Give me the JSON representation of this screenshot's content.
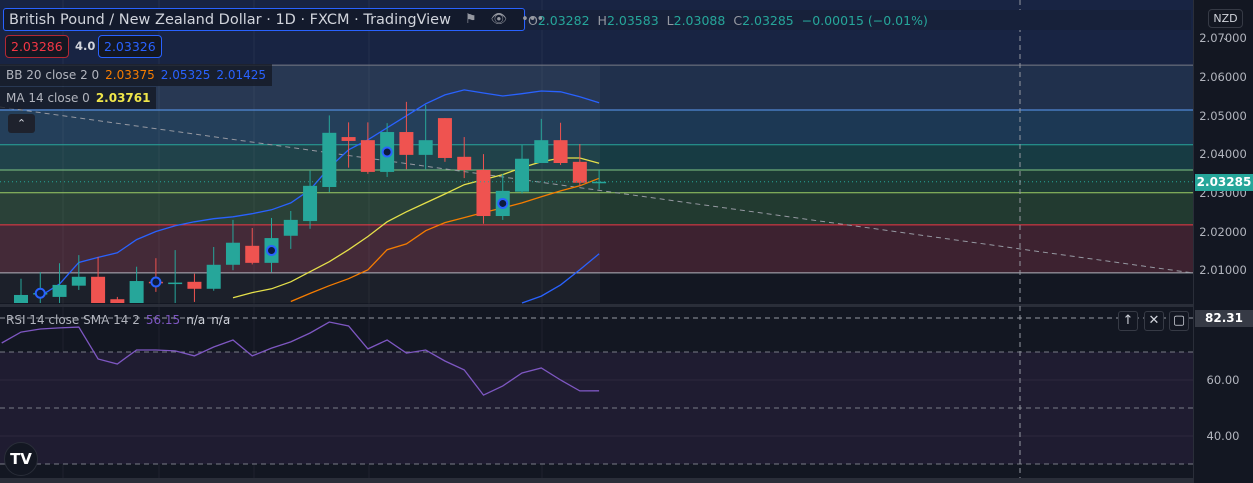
{
  "header": {
    "title": "British Pound / New Zealand Dollar · 1D · FXCM · TradingView",
    "icons": [
      "flag-icon",
      "eye-icon",
      "more-icon"
    ]
  },
  "ohlc": {
    "o_label": "O",
    "o": "2.03282",
    "h_label": "H",
    "h": "2.03583",
    "l_label": "L",
    "l": "2.03088",
    "c_label": "C",
    "c": "2.03285",
    "change": "−0.00015 (−0.01%)"
  },
  "trade": {
    "sell": "2.03286",
    "spread": "4.0",
    "buy": "2.03326"
  },
  "legend": {
    "bb": {
      "name": "BB 20 close 2 0",
      "basis": "2.03375",
      "upper": "2.05325",
      "lower": "2.01425"
    },
    "ma": {
      "name": "MA 14 close 0",
      "value": "2.03761"
    }
  },
  "axis": {
    "currency": "NZD",
    "labels": [
      "2.07000",
      "2.06000",
      "2.05000",
      "2.04000",
      "2.03000",
      "2.02000",
      "2.01000"
    ],
    "last_price": "2.03285"
  },
  "rsi": {
    "name": "RSI 14 close SMA 14 2",
    "value": "56.15",
    "na1": "n/a",
    "na2": "n/a",
    "axis_labels": [
      "60.00",
      "40.00"
    ],
    "crosshair_value": "82.31"
  },
  "colors": {
    "up": "#26a69a",
    "down": "#ef5350",
    "bb_band": "#2962ff",
    "bb_basis": "#f57c00",
    "ma": "#e5e04a",
    "rsi": "#7e57c2"
  },
  "chart_data": {
    "type": "candlestick",
    "symbol": "GBPNZD",
    "interval": "1D",
    "ylim": [
      2.0,
      2.07
    ],
    "candles": [
      [
        2.0015,
        2.0078,
        2.001,
        2.0036
      ],
      [
        2.004,
        2.0095,
        2.001,
        2.0041
      ],
      [
        2.0031,
        2.0118,
        2.0015,
        2.0062
      ],
      [
        2.006,
        2.0139,
        2.0049,
        2.0083
      ],
      [
        2.0083,
        2.0134,
        2.001,
        2.0015
      ],
      [
        2.0025,
        2.0031,
        2.0,
        2.0015
      ],
      [
        2.0015,
        2.0109,
        2.001,
        2.0072
      ],
      [
        2.007,
        2.0131,
        2.0044,
        2.0069
      ],
      [
        2.0068,
        2.0152,
        2.001,
        2.0068
      ],
      [
        2.007,
        2.0091,
        2.0018,
        2.0052
      ],
      [
        2.0052,
        2.016,
        2.0047,
        2.0114
      ],
      [
        2.0114,
        2.023,
        2.01,
        2.0171
      ],
      [
        2.0163,
        2.0209,
        2.0115,
        2.0119
      ],
      [
        2.0119,
        2.0235,
        2.0095,
        2.0183
      ],
      [
        2.0189,
        2.0253,
        2.0155,
        2.023
      ],
      [
        2.0227,
        2.0357,
        2.0207,
        2.0318
      ],
      [
        2.0315,
        2.05,
        2.0302,
        2.0455
      ],
      [
        2.0444,
        2.0482,
        2.0365,
        2.0434
      ],
      [
        2.0436,
        2.0482,
        2.0349,
        2.0354
      ],
      [
        2.0354,
        2.048,
        2.0341,
        2.0457
      ],
      [
        2.0457,
        2.0535,
        2.0361,
        2.0398
      ],
      [
        2.0398,
        2.0527,
        2.0361,
        2.0436
      ],
      [
        2.0493,
        2.0493,
        2.038,
        2.039
      ],
      [
        2.0393,
        2.0444,
        2.0338,
        2.0359
      ],
      [
        2.0359,
        2.04,
        2.022,
        2.024
      ],
      [
        2.024,
        2.0349,
        2.023,
        2.0305
      ],
      [
        2.0303,
        2.0424,
        2.0298,
        2.0388
      ],
      [
        2.0377,
        2.0491,
        2.0377,
        2.0436
      ],
      [
        2.0436,
        2.0481,
        2.0372,
        2.0377
      ],
      [
        2.038,
        2.0426,
        2.0318,
        2.0326
      ],
      [
        2.03282,
        2.03583,
        2.03088,
        2.03285
      ]
    ],
    "markers_at": [
      1,
      7,
      13,
      19,
      25
    ],
    "bb_upper": [
      null,
      2.0033,
      2.0064,
      2.012,
      2.0133,
      2.0145,
      2.0179,
      2.02,
      2.0215,
      2.0225,
      2.0233,
      2.0238,
      2.0246,
      2.0256,
      2.0274,
      2.0308,
      2.0365,
      2.0411,
      2.0437,
      2.0468,
      2.0499,
      2.053,
      2.0553,
      2.0566,
      2.0558,
      2.055,
      2.0556,
      2.0563,
      2.0561,
      2.0548,
      2.05325
    ],
    "bb_lower": [
      null,
      null,
      null,
      null,
      null,
      null,
      null,
      null,
      null,
      null,
      null,
      null,
      null,
      null,
      null,
      null,
      null,
      null,
      null,
      null,
      null,
      null,
      null,
      null,
      null,
      null,
      2.0006,
      2.0033,
      2.0062,
      2.0101,
      2.01425
    ],
    "bb_basis": [
      null,
      null,
      null,
      null,
      null,
      null,
      null,
      null,
      null,
      null,
      null,
      null,
      null,
      null,
      2.0019,
      2.004,
      2.006,
      2.0078,
      2.0101,
      2.0153,
      2.0168,
      2.0202,
      2.0223,
      2.0236,
      2.0249,
      2.0261,
      2.0274,
      2.029,
      2.0305,
      2.0318,
      2.03375
    ],
    "ma14": [
      null,
      null,
      null,
      null,
      null,
      null,
      null,
      null,
      null,
      null,
      null,
      2.0029,
      2.0042,
      2.0052,
      2.007,
      2.0096,
      2.0122,
      2.0153,
      2.0187,
      2.0225,
      2.0251,
      2.0274,
      2.0297,
      2.0321,
      2.0334,
      2.0347,
      2.0365,
      2.038,
      2.039,
      2.039,
      2.03761
    ],
    "levels": [
      2.063,
      2.0514,
      2.0424,
      2.0359,
      2.03,
      2.0217,
      2.0093
    ],
    "rsi": [
      73.2,
      77.1,
      78.2,
      78.6,
      78.9,
      67.5,
      65.7,
      70.7,
      70.7,
      70.4,
      68.6,
      71.8,
      74.3,
      68.6,
      71.4,
      73.6,
      76.8,
      80.7,
      79.3,
      71.1,
      74.3,
      69.6,
      70.7,
      66.8,
      63.6,
      54.6,
      57.9,
      62.5,
      64.3,
      60.0,
      56.1,
      56.15
    ],
    "rsi_levels": [
      70,
      50,
      30
    ]
  }
}
